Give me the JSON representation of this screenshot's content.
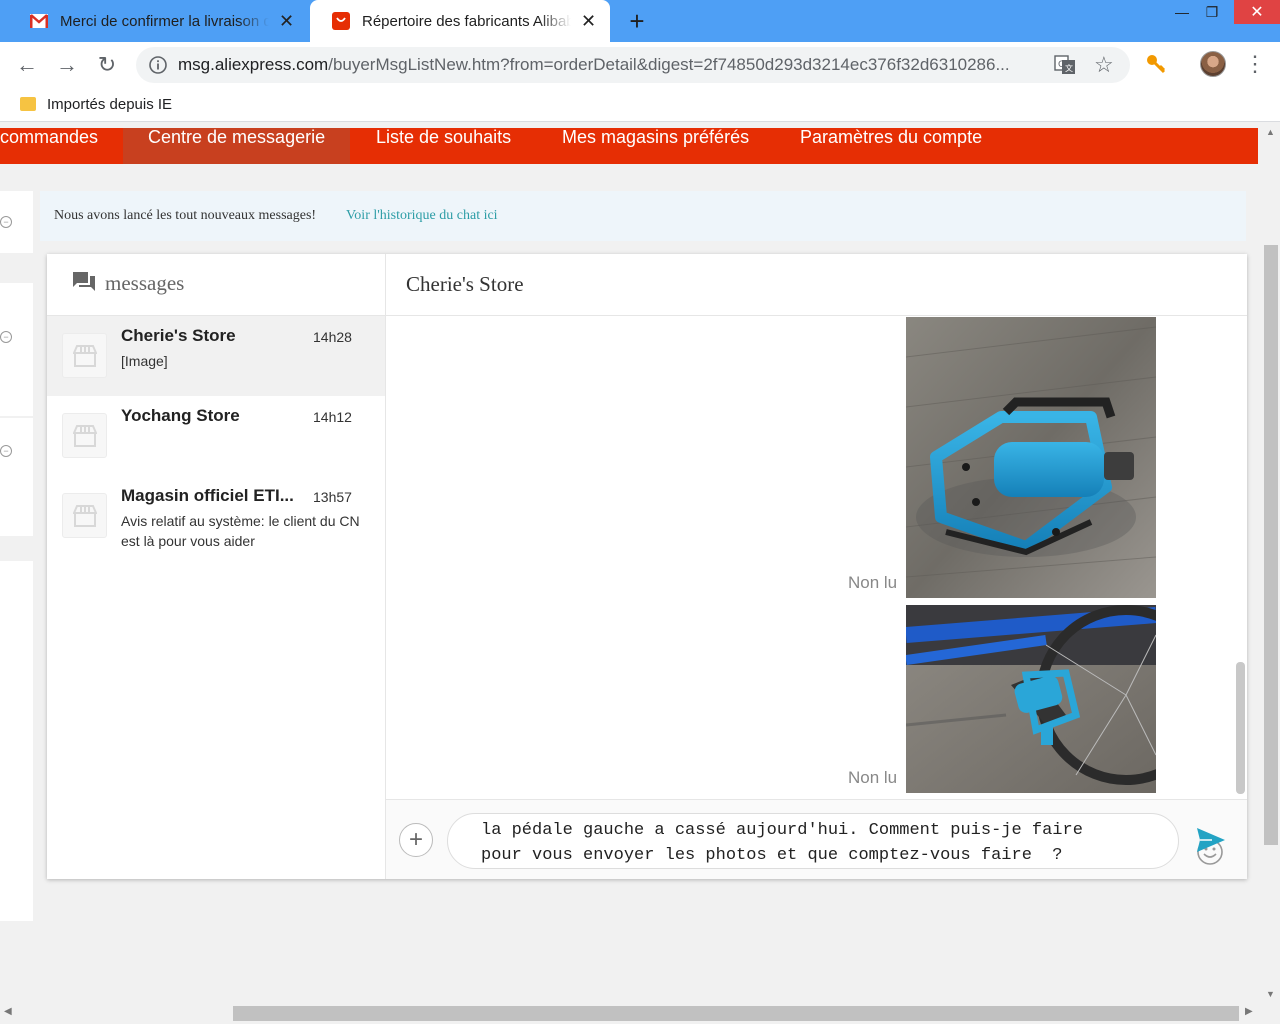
{
  "browser": {
    "tabs": [
      {
        "title": "Merci de confirmer la livraison de",
        "active": false
      },
      {
        "title": "Répertoire des fabricants Alibaba",
        "active": true
      }
    ],
    "new_tab_symbol": "+",
    "window_controls": {
      "minimize": "—",
      "maximize": "❐",
      "close": "✕"
    },
    "url_host": "msg.aliexpress.com",
    "url_path": "/buyerMsgListNew.htm?from=orderDetail&digest=2f74850d293d3214ec376f32d6310286...",
    "bookmarks": [
      {
        "label": "Importés depuis IE",
        "icon": "folder-icon"
      }
    ]
  },
  "page": {
    "nav": {
      "items": [
        {
          "label": "commandes",
          "active": false
        },
        {
          "label": "Centre de messagerie",
          "active": true
        },
        {
          "label": "Liste de souhaits",
          "active": false
        },
        {
          "label": "Mes magasins préférés",
          "active": false
        },
        {
          "label": "Paramètres du compte",
          "active": false
        }
      ],
      "color": "#e62e04"
    },
    "notice": {
      "text": "Nous avons lancé les tout nouveaux messages!",
      "link": "Voir l'historique du chat ici"
    },
    "conversations": {
      "header": "messages",
      "items": [
        {
          "name": "Cherie's Store",
          "time": "14h28",
          "preview": "[Image]",
          "selected": true
        },
        {
          "name": "Yochang Store",
          "time": "14h12",
          "preview": "",
          "selected": false
        },
        {
          "name": "Magasin officiel ETI...",
          "time": "13h57",
          "preview": "Avis relatif au système: le client du CN est là pour vous aider",
          "selected": false
        }
      ]
    },
    "chat": {
      "store_name": "Cherie's Store",
      "messages": [
        {
          "type": "image",
          "status": "Non lu",
          "description": "blue-pedal-photo"
        },
        {
          "type": "image",
          "status": "Non lu",
          "description": "bike-with-pedal-photo"
        }
      ],
      "input_text": "la pédale gauche a cassé aujourd'hui. Comment puis-je faire pour vous envoyer les photos et que comptez-vous faire  ?",
      "accent": "#23a3c4"
    }
  }
}
